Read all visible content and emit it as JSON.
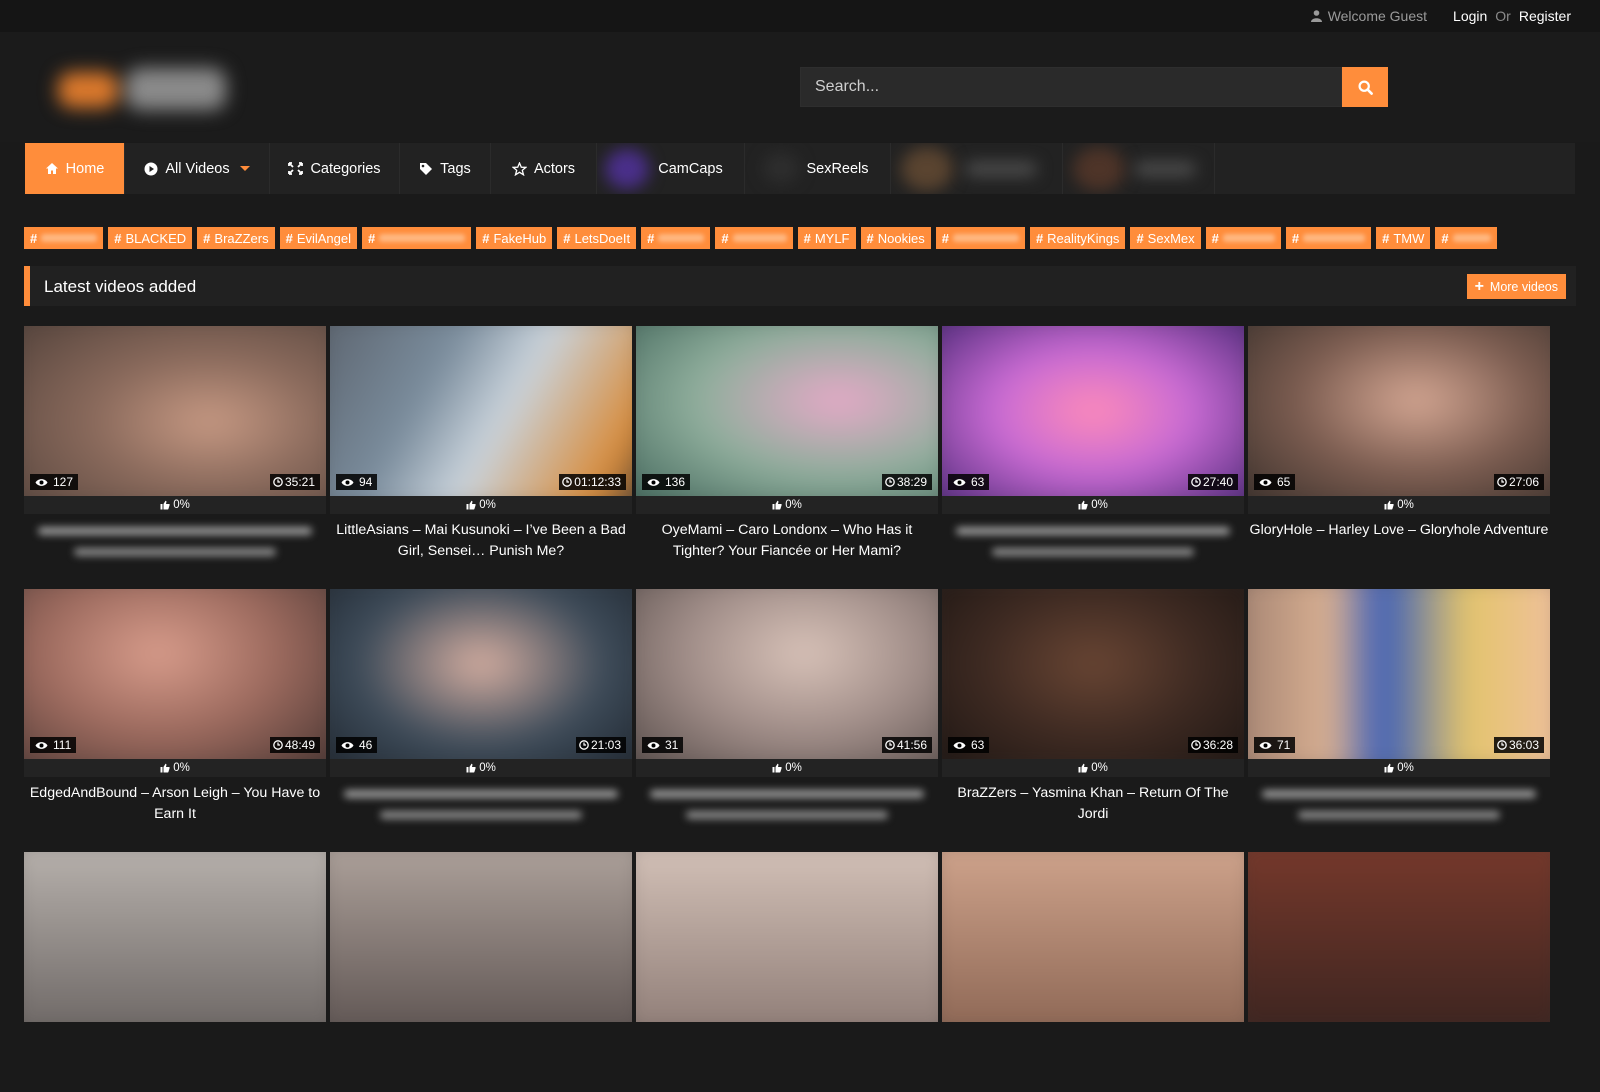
{
  "topbar": {
    "welcome": "Welcome Guest",
    "login": "Login",
    "or": "Or",
    "register": "Register"
  },
  "search": {
    "placeholder": "Search..."
  },
  "nav": {
    "home": "Home",
    "all_videos": "All Videos",
    "categories": "Categories",
    "tags": "Tags",
    "actors": "Actors",
    "camcaps": "CamCaps",
    "sexreels": "SexReels"
  },
  "tags": [
    "",
    "BLACKED",
    "BraZZers",
    "EvilAngel",
    "",
    "FakeHub",
    "LetsDoeIt",
    "",
    "",
    "MYLF",
    "Nookies",
    "",
    "RealityKings",
    "SexMex",
    "",
    "",
    "TMW",
    ""
  ],
  "section": {
    "title": "Latest videos added",
    "more": "More videos"
  },
  "accent_color": "#ff8d3b",
  "videos": [
    {
      "views": "127",
      "duration": "35:21",
      "rating": "0%",
      "title": ""
    },
    {
      "views": "94",
      "duration": "01:12:33",
      "rating": "0%",
      "title": "LittleAsians – Mai Kusunoki – I’ve Been a Bad Girl, Sensei… Punish Me?"
    },
    {
      "views": "136",
      "duration": "38:29",
      "rating": "0%",
      "title": "OyeMami – Caro Londonx – Who Has it Tighter? Your Fiancée or Her Mami?"
    },
    {
      "views": "63",
      "duration": "27:40",
      "rating": "0%",
      "title": ""
    },
    {
      "views": "65",
      "duration": "27:06",
      "rating": "0%",
      "title": "GloryHole – Harley Love – Gloryhole Adventure"
    },
    {
      "views": "111",
      "duration": "48:49",
      "rating": "0%",
      "title": "EdgedAndBound – Arson Leigh – You Have to Earn It"
    },
    {
      "views": "46",
      "duration": "21:03",
      "rating": "0%",
      "title": ""
    },
    {
      "views": "31",
      "duration": "41:56",
      "rating": "0%",
      "title": ""
    },
    {
      "views": "63",
      "duration": "36:28",
      "rating": "0%",
      "title": "BraZZers – Yasmina Khan – Return Of The Jordi"
    },
    {
      "views": "71",
      "duration": "36:03",
      "rating": "0%",
      "title": ""
    },
    {
      "views": "",
      "duration": "",
      "rating": "",
      "title": ""
    },
    {
      "views": "",
      "duration": "",
      "rating": "",
      "title": ""
    },
    {
      "views": "",
      "duration": "",
      "rating": "",
      "title": ""
    },
    {
      "views": "",
      "duration": "",
      "rating": "",
      "title": ""
    },
    {
      "views": "",
      "duration": "",
      "rating": "",
      "title": ""
    }
  ]
}
